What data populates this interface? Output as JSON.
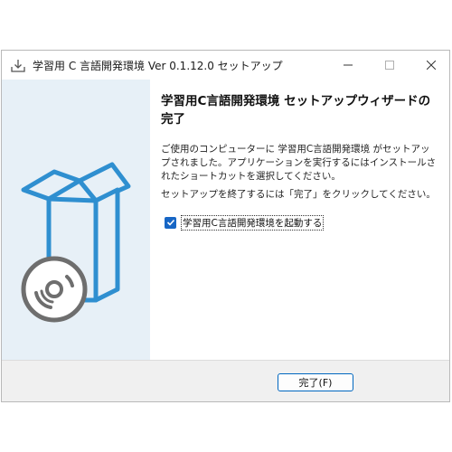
{
  "window": {
    "title": "学習用 C 言語開発環境 Ver 0.1.12.0 セットアップ"
  },
  "wizard": {
    "heading": "学習用C言語開発環境 セットアップウィザードの完了",
    "paragraph1": "ご使用のコンピューターに 学習用C言語開発環境 がセットアップされました。アプリケーションを実行するにはインストールされたショートカットを選択してください。",
    "paragraph2": "セットアップを終了するには「完了」をクリックしてください。",
    "launch_checkbox_label": "学習用C言語開発環境を起動する",
    "launch_checked": true
  },
  "buttons": {
    "finish_label": "完了(F)"
  },
  "colors": {
    "accent": "#1766c5",
    "left_panel": "#e7f0f7",
    "box_blue": "#2f8fd0",
    "disc_gray": "#6e6e6e"
  },
  "icons": [
    "installer-icon",
    "minimize-icon",
    "maximize-icon",
    "close-icon",
    "box-disc-illustration",
    "checkmark-icon"
  ]
}
